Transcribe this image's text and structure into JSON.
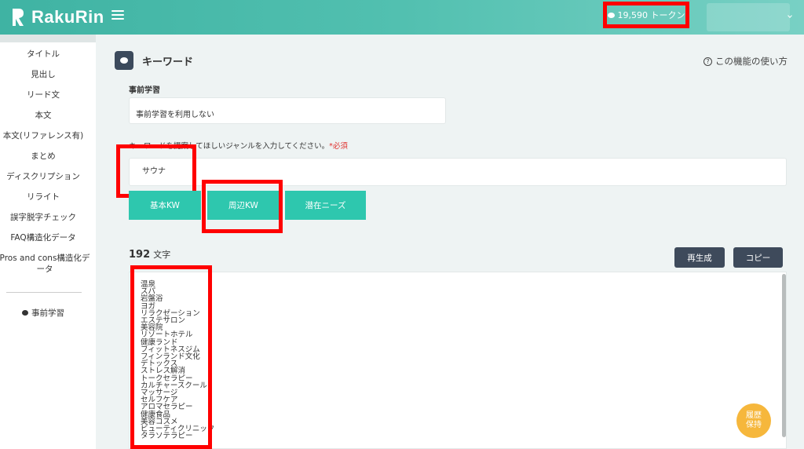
{
  "header": {
    "brand": "RakuRin",
    "tokens": "19,590 トークン"
  },
  "sidebar": {
    "items": [
      {
        "label": "タイトル"
      },
      {
        "label": "見出し"
      },
      {
        "label": "リード文"
      },
      {
        "label": "本文"
      },
      {
        "label": "本文(リファレンス有)"
      },
      {
        "label": "まとめ"
      },
      {
        "label": "ディスクリプション"
      },
      {
        "label": "リライト"
      },
      {
        "label": "誤字脱字チェック"
      },
      {
        "label": "FAQ構造化データ"
      },
      {
        "label": "Pros and cons構造化データ"
      }
    ],
    "prelearn": "事前学習"
  },
  "main": {
    "title": "キーワード",
    "help": "この機能の使い方",
    "prelearn_label": "事前学習",
    "prelearn_value": "事前学習を利用しない",
    "genre_label": "キーワードを提案してほしいジャンルを入力してください。",
    "required": "*必須",
    "genre_value": "サウナ",
    "tabs": [
      {
        "label": "基本KW"
      },
      {
        "label": "周辺KW"
      },
      {
        "label": "潜在ニーズ"
      }
    ],
    "char_count": "192",
    "char_unit": "文字",
    "regenerate": "再生成",
    "copy": "コピー",
    "keywords": [
      "温泉",
      "スパ",
      "岩盤浴",
      "ヨガ",
      "リラクゼーション",
      "エステサロン",
      "美容院",
      "リゾートホテル",
      "健康ランド",
      "フィットネスジム",
      "フィンランド文化",
      "デトックス",
      "ストレス解消",
      "トークセラピー",
      "カルチャースクール",
      "マッサージ",
      "セルフケア",
      "アロマセラピー",
      "健康食品",
      "美容コスメ",
      "ビューティクリニック",
      "タラソテラピー"
    ],
    "history": [
      "履歴",
      "保持"
    ]
  },
  "colors": {
    "accent": "#2ec7ae",
    "dark_button": "#3e4a5b",
    "highlight": "#ff0000",
    "history": "#f6b73c"
  }
}
